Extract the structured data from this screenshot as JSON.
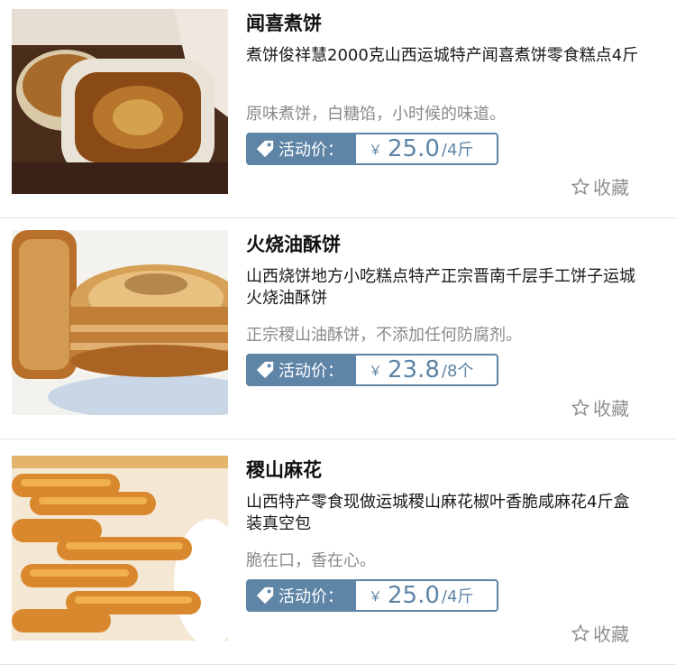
{
  "products": [
    {
      "title": "闻喜煮饼",
      "description": "煮饼俊祥慧2000克山西运城特产闻喜煮饼零食糕点4斤",
      "subtitle": "原味煮饼，白糖馅，小时候的味道。",
      "price_label": "活动价：",
      "currency": "￥",
      "price": "25.0",
      "unit": "/4斤",
      "collect_label": "收藏"
    },
    {
      "title": "火烧油酥饼",
      "description": "山西烧饼地方小吃糕点特产正宗晋南千层手工饼子运城火烧油酥饼",
      "subtitle": "正宗稷山油酥饼，不添加任何防腐剂。",
      "price_label": "活动价：",
      "currency": "￥",
      "price": "23.8",
      "unit": "/8个",
      "collect_label": "收藏"
    },
    {
      "title": "稷山麻花",
      "description": "山西特产零食现做运城稷山麻花椒叶香脆咸麻花4斤盒装真空包",
      "subtitle": "脆在口，香在心。",
      "price_label": "活动价：",
      "currency": "￥",
      "price": "25.0",
      "unit": "/4斤",
      "collect_label": "收藏"
    }
  ],
  "colors": {
    "accent": "#5e84a6",
    "muted_text": "#8a8a8a",
    "divider": "#e3e3e3"
  },
  "icons": {
    "price_tag": "tag-icon",
    "collect": "star-outline-icon"
  }
}
